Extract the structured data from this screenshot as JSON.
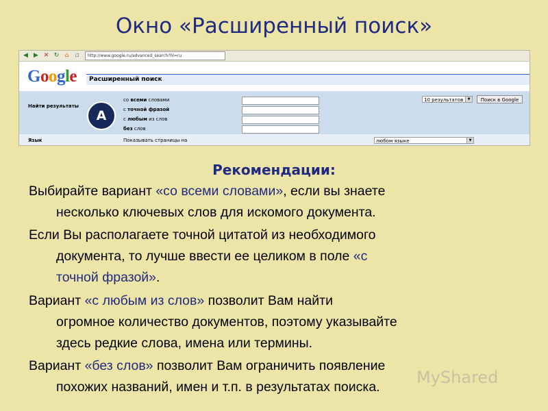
{
  "slide": {
    "title": "Окно «Расширенный поиск»",
    "recommendations_heading": "Рекомендации:"
  },
  "browser": {
    "address": "http://www.google.ru/advanced_search?hl=ru",
    "logo": [
      "G",
      "o",
      "o",
      "g",
      "l",
      "e"
    ],
    "logo_colors": [
      "#3366cc",
      "#cc2222",
      "#ee9900",
      "#3366cc",
      "#339933",
      "#cc2222"
    ],
    "header_title": "Расширенный поиск",
    "find_results_label": "Найти результаты",
    "badge": "A",
    "options": [
      {
        "pre": "со ",
        "bold": "всеми",
        "post": " словами"
      },
      {
        "pre": "с ",
        "bold": "точной фразой",
        "post": ""
      },
      {
        "pre": "с ",
        "bold": "любым",
        "post": " из слов"
      },
      {
        "pre": "",
        "bold": "без",
        "post": " слов"
      }
    ],
    "results_select": "10 результатов",
    "search_button": "Поиск в Google",
    "language_label": "Язык",
    "language_desc": "Показывать страницы на",
    "language_select": "любом языке"
  },
  "paragraphs": [
    {
      "line1_pre": "Выбирайте вариант ",
      "line1_hl": "«со всеми словами»",
      "line1_post": ", если вы знаете",
      "line2": "несколько ключевых слов для искомого документа."
    },
    {
      "line1": "Если Вы располагаете точной цитатой из необходимого",
      "line2_pre": "документа, то лучше ввести ее целиком в поле ",
      "line2_hl": "«с",
      "line3_hl": "точной фразой»",
      "line3_post": "."
    },
    {
      "line1_pre": "Вариант ",
      "line1_hl": "«с любым из слов»",
      "line1_post": " позволит Вам найти",
      "line2": "огромное количество документов, поэтому указывайте",
      "line3": "здесь редкие слова, имена или термины."
    },
    {
      "line1_pre": "Вариант ",
      "line1_hl": "«без слов»",
      "line1_post": " позволит Вам ограничить появление",
      "line2": "похожих названий, имен и т.п. в результатах поиска."
    }
  ],
  "watermark": "MyShared"
}
